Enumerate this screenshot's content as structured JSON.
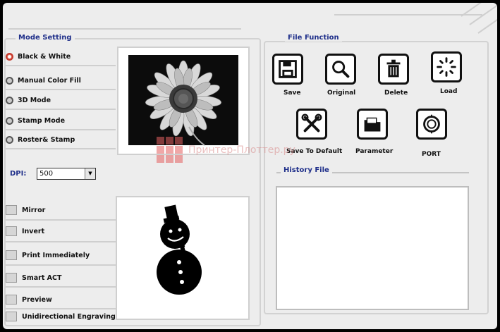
{
  "mode_setting": {
    "title": "Mode Setting",
    "modes": [
      {
        "label": "Black & White",
        "selected": true
      },
      {
        "label": "Manual Color Fill",
        "selected": false
      },
      {
        "label": "3D Mode",
        "selected": false
      },
      {
        "label": "Stamp Mode",
        "selected": false
      },
      {
        "label": "Roster& Stamp",
        "selected": false
      }
    ],
    "dpi_label": "DPI:",
    "dpi_value": "500"
  },
  "options": [
    {
      "label": "Mirror",
      "checked": false
    },
    {
      "label": "Invert",
      "checked": false
    },
    {
      "label": "Print Immediately",
      "checked": false
    },
    {
      "label": "Smart ACT",
      "checked": false
    },
    {
      "label": "Preview",
      "checked": false
    },
    {
      "label": "Unidirectional Engraving",
      "checked": false
    }
  ],
  "file_function": {
    "title": "File Function",
    "buttons": [
      {
        "label": "Save",
        "icon": "floppy-disk-icon"
      },
      {
        "label": "Original",
        "icon": "magnifier-icon"
      },
      {
        "label": "Delete",
        "icon": "trash-icon"
      },
      {
        "label": "Load",
        "icon": "loading-spinner-icon"
      },
      {
        "label": "Save To Default",
        "icon": "tools-icon"
      },
      {
        "label": "Parameter",
        "icon": "folder-icon"
      },
      {
        "label": "PORT",
        "icon": "port-icon"
      }
    ]
  },
  "history": {
    "title": "History File"
  },
  "watermark": {
    "text": "Принтер-Плоттер.ру"
  }
}
